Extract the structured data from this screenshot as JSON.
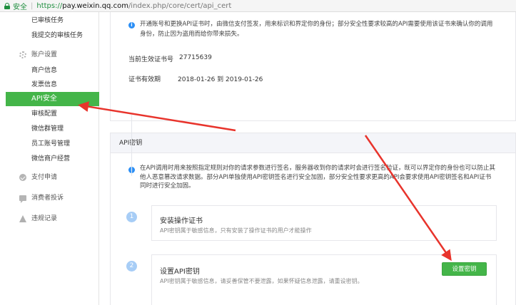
{
  "addressbar": {
    "secure_label": "安全",
    "separator": "|",
    "scheme": "https://",
    "host": "pay.weixin.qq.com",
    "path": "/index.php/core/cert/api_cert"
  },
  "sidebar": {
    "items": [
      {
        "label": "已审核任务"
      },
      {
        "label": "我提交的审核任务"
      },
      {
        "label": "账户设置",
        "icon": "gear-icon"
      },
      {
        "label": "商户信息"
      },
      {
        "label": "发票信息"
      },
      {
        "label": "API安全",
        "active": true
      },
      {
        "label": "审核配置"
      },
      {
        "label": "微信群管理"
      },
      {
        "label": "员工账号管理"
      },
      {
        "label": "微信商户经营"
      },
      {
        "label": "支付申请",
        "icon": "check-circle-icon"
      },
      {
        "label": "消费者投诉",
        "icon": "chat-icon"
      },
      {
        "label": "违规记录",
        "icon": "warning-icon"
      }
    ]
  },
  "cert_card": {
    "notice_line1": "开通账号和更换API证书时，由微信支付签发，用来标识和界定你的身份；部分安全性要求较高的API需要使用该证书来确认你的调用",
    "notice_line2": "身份，防止因为盗用而给你带来损失。",
    "serial_label": "当前生效证书号",
    "serial_value": "27715639",
    "validity_label": "证书有效期",
    "validity_value": "2018-01-26  到  2019-01-26"
  },
  "key_card": {
    "header": "API密钥",
    "notice_line1": "在API调用时用来按照指定规则对你的请求参数进行签名，服务器收到你的请求时会进行签名验证，既可以界定你的身份也可以防止其",
    "notice_line2": "他人恶意篡改请求数据。部分API单独使用API密钥签名进行安全加固，部分安全性要求更高的API会要求使用API密钥签名和API证书",
    "notice_line3": "同时进行安全加固。",
    "steps": [
      {
        "num": "1",
        "title": "安装操作证书",
        "desc": "API密钥属于敏感信息，只有安装了操作证书的用户才能操作"
      },
      {
        "num": "2",
        "title": "设置API密钥",
        "desc": "API密钥属于敏感信息，请妥善保管不要泄露，如果怀疑信息泄露，请重设密钥。"
      }
    ],
    "set_key_button": "设置密钥"
  },
  "colors": {
    "accent_green": "#44b549",
    "info_blue": "#2b8ff6",
    "annotation_red": "#e8342c"
  }
}
